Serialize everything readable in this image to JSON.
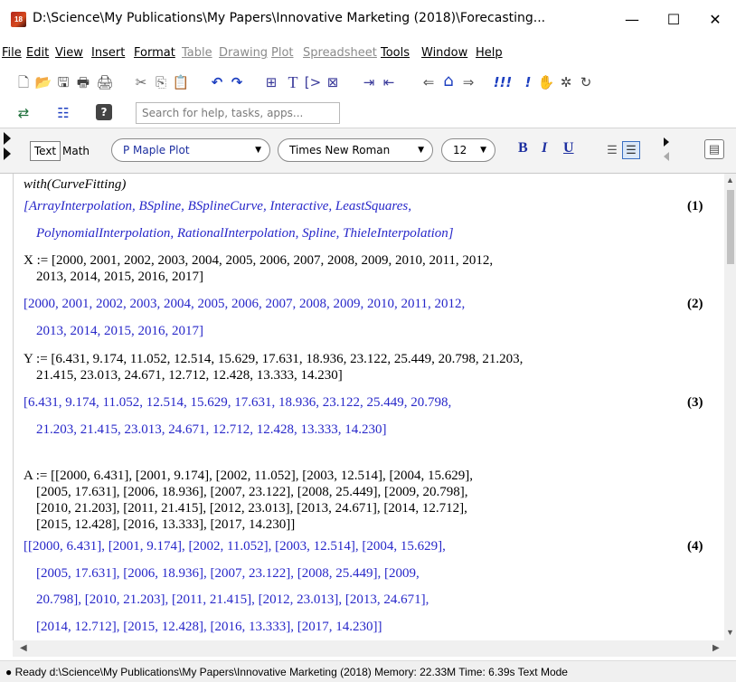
{
  "window": {
    "title": "D:\\Science\\My Publications\\My Papers\\Innovative Marketing (2018)\\Forecasting...",
    "app_icon_text": "18",
    "minimize": "—",
    "maximize": "☐",
    "close": "✕"
  },
  "menu": [
    "File",
    "Edit",
    "View",
    "Insert",
    "Format",
    "Table",
    "Drawing",
    "Plot",
    "Spreadsheet",
    "Tools",
    "Window",
    "Help"
  ],
  "menu_disabled": [
    "Table",
    "Drawing",
    "Plot",
    "Spreadsheet"
  ],
  "toolbar1": [
    {
      "name": "new-document-icon",
      "glyph": "🗋"
    },
    {
      "name": "open-folder-icon",
      "glyph": "📂"
    },
    {
      "name": "save-icon",
      "glyph": "🖫"
    },
    {
      "name": "print-icon",
      "glyph": "🖶"
    },
    {
      "name": "print-preview-icon",
      "glyph": "🖨"
    },
    {
      "name": "cut-icon",
      "glyph": "✂"
    },
    {
      "name": "copy-icon",
      "glyph": "⎘"
    },
    {
      "name": "paste-icon",
      "glyph": "📋"
    },
    {
      "name": "undo-icon",
      "glyph": "↶"
    },
    {
      "name": "redo-icon",
      "glyph": "↷"
    },
    {
      "name": "insert-math-icon",
      "glyph": "⊞"
    },
    {
      "name": "insert-text-icon",
      "glyph": "T"
    },
    {
      "name": "execution-group-icon",
      "glyph": "[>"
    },
    {
      "name": "mathematical-icon",
      "glyph": "⊠"
    },
    {
      "name": "indent-icon",
      "glyph": "⇥"
    },
    {
      "name": "outdent-icon",
      "glyph": "⇤"
    },
    {
      "name": "back-icon",
      "glyph": "⇐"
    },
    {
      "name": "home-icon",
      "glyph": "⌂"
    },
    {
      "name": "forward-icon",
      "glyph": "⇒"
    },
    {
      "name": "execute-all-icon",
      "glyph": "!!!"
    },
    {
      "name": "execute-icon",
      "glyph": "!"
    },
    {
      "name": "stop-icon",
      "glyph": "✋"
    },
    {
      "name": "debug-icon",
      "glyph": "✲"
    },
    {
      "name": "restart-icon",
      "glyph": "↻"
    }
  ],
  "toolbar2": [
    {
      "name": "switch-icon",
      "glyph": "⇄"
    },
    {
      "name": "add-section-icon",
      "glyph": "☷"
    },
    {
      "name": "help-icon",
      "glyph": "?"
    }
  ],
  "search": {
    "placeholder": "Search for help, tasks, apps..."
  },
  "context": {
    "text_mode": "Text",
    "math_mode": "Math",
    "style": "P  Maple Plot",
    "font": "Times New Roman",
    "size": "12",
    "bold": "B",
    "italic": "I",
    "underline": "U"
  },
  "document": {
    "cmd1": "with(CurveFitting)",
    "out1_line1": "[ArrayInterpolation, BSpline, BSplineCurve, Interactive, LeastSquares,",
    "out1_line2": "PolynomialInterpolation, RationalInterpolation, Spline, ThieleInterpolation]",
    "eq1": "(1)",
    "cmd2_line1": "X := [2000, 2001, 2002, 2003, 2004, 2005, 2006, 2007, 2008, 2009, 2010, 2011, 2012,",
    "cmd2_line2": "2013, 2014, 2015, 2016, 2017]",
    "out2_line1": "[2000, 2001, 2002, 2003, 2004, 2005, 2006, 2007, 2008, 2009, 2010, 2011, 2012,",
    "out2_line2": "2013, 2014, 2015, 2016, 2017]",
    "eq2": "(2)",
    "cmd3_line1": "Y := [6.431, 9.174, 11.052, 12.514, 15.629, 17.631, 18.936, 23.122, 25.449, 20.798, 21.203,",
    "cmd3_line2": "21.415, 23.013, 24.671, 12.712, 12.428, 13.333, 14.230]",
    "out3_line1": "[6.431, 9.174, 11.052, 12.514, 15.629, 17.631, 18.936, 23.122, 25.449, 20.798,",
    "out3_line2": "21.203, 21.415, 23.013, 24.671, 12.712, 12.428, 13.333, 14.230]",
    "eq3": "(3)",
    "cmd4_line1": "A := [[2000, 6.431], [2001, 9.174], [2002, 11.052], [2003, 12.514], [2004, 15.629],",
    "cmd4_line2": "[2005, 17.631], [2006, 18.936], [2007, 23.122], [2008, 25.449], [2009, 20.798],",
    "cmd4_line3": "[2010, 21.203], [2011, 21.415], [2012, 23.013], [2013, 24.671], [2014, 12.712],",
    "cmd4_line4": "[2015, 12.428], [2016, 13.333], [2017, 14.230]]",
    "out4_line1": "[[2000, 6.431], [2001, 9.174], [2002, 11.052], [2003, 12.514], [2004, 15.629],",
    "out4_line2": "[2005, 17.631], [2006, 18.936], [2007, 23.122], [2008, 25.449], [2009,",
    "out4_line3": "20.798], [2010, 21.203], [2011, 21.415], [2012, 23.013], [2013, 24.671],",
    "out4_line4": "[2014, 12.712], [2015, 12.428], [2016, 13.333], [2017, 14.230]]",
    "eq4": "(4)"
  },
  "status": {
    "text": "● Ready  d:\\Science\\My Publications\\My Papers\\Innovative Marketing (2018)  Memory: 22.33M  Time: 6.39s  Text Mode"
  },
  "colors": {
    "output": "#2727c9",
    "input": "#000000",
    "accent_blue": "#1d2fa0"
  }
}
